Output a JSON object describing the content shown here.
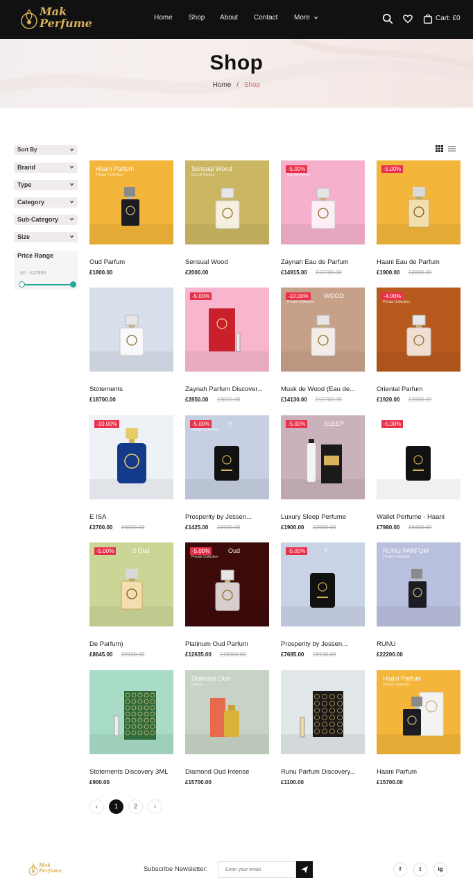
{
  "header": {
    "logo_line1": "Mak",
    "logo_line2": "Perfume",
    "nav": [
      {
        "label": "Home"
      },
      {
        "label": "Shop"
      },
      {
        "label": "About"
      },
      {
        "label": "Contact"
      },
      {
        "label": "More"
      }
    ],
    "cart_label": "Cart: £0",
    "icons": [
      "search-icon",
      "heart-icon",
      "bag-icon"
    ]
  },
  "hero": {
    "title": "Shop",
    "breadcrumb": {
      "home": "Home",
      "separator": "/",
      "current": "Shop"
    }
  },
  "sidebar": {
    "filters": [
      {
        "label": "Sort By"
      },
      {
        "label": "Brand"
      },
      {
        "label": "Type"
      },
      {
        "label": "Category"
      },
      {
        "label": "Sub-Category"
      },
      {
        "label": "Size"
      }
    ],
    "price_range": {
      "title": "Price Range",
      "value_text": "£0 - £22950",
      "slider_color": "#26a69a"
    }
  },
  "view_toggles": [
    "grid-view-icon",
    "list-view-icon"
  ],
  "products": [
    {
      "name": "Oud Parfum",
      "price": "£1800.00",
      "old_price": "",
      "badge": "",
      "overlay": "Haani Parfum",
      "overlay_sub": "Private Collection",
      "bg": "#f3b53a",
      "bottle": "dark"
    },
    {
      "name": "Sensual Wood",
      "price": "£2000.00",
      "old_price": "",
      "badge": "",
      "overlay": "Sensual Wood",
      "overlay_sub": "Eau de Parfum",
      "bg": "#cbb662",
      "bottle": "clear"
    },
    {
      "name": "Zaynah Eau de Parfum",
      "price": "£14915.00",
      "old_price": "£15700.00",
      "badge": "-5.00%",
      "overlay": "",
      "overlay_sub": "Eau de Parfum",
      "bg": "#f5b1cc",
      "bottle": "clear"
    },
    {
      "name": "Haani Eau de Parfum",
      "price": "£1900.00",
      "old_price": "£2000.00",
      "badge": "-5.00%",
      "overlay": "",
      "overlay_sub": "",
      "bg": "#f3b53a",
      "bottle": "gold"
    },
    {
      "name": "Stotements",
      "price": "£18700.00",
      "old_price": "",
      "badge": "",
      "overlay": "",
      "overlay_sub": "",
      "bg": "#d7dfea",
      "bottle": "clear"
    },
    {
      "name": "Zaynah Parfum Discover...",
      "price": "£2850.00",
      "old_price": "£3000.00",
      "badge": "-5.00%",
      "overlay": "",
      "overlay_sub": "",
      "bg": "#f7b6ce",
      "bottle": "box-red"
    },
    {
      "name": "Musk de Wood (Eau de...",
      "price": "£14130.00",
      "old_price": "£15700.00",
      "badge": "-10.00%",
      "overlay": "WOOD",
      "overlay_sub": "Private Collection",
      "bg": "#c7a089",
      "bottle": "clear"
    },
    {
      "name": "Oriental Parfum",
      "price": "£1920.00",
      "old_price": "£2000.00",
      "badge": "-4.00%",
      "overlay": "",
      "overlay_sub": "Private Collection",
      "bg": "#b85a1e",
      "bottle": "clear"
    },
    {
      "name": "E ISA",
      "price": "£2700.00",
      "old_price": "£3000.00",
      "badge": "-10.00%",
      "overlay": "",
      "overlay_sub": "",
      "bg": "#eef2f6",
      "bottle": "blue"
    },
    {
      "name": "Prosperity by Jessen...",
      "price": "£1425.00",
      "old_price": "£1500.00",
      "badge": "-5.00%",
      "overlay": "Y",
      "overlay_sub": "Parfum Collection",
      "bg": "#c6d0e2",
      "bottle": "wallet"
    },
    {
      "name": "Luxury Sleep Perfume",
      "price": "£1900.00",
      "old_price": "£2000.00",
      "badge": "-5.00%",
      "overlay": "SLEEP",
      "overlay_sub": "",
      "bg": "#c9b2bb",
      "bottle": "spray"
    },
    {
      "name": "Wallet Perfume - Haani",
      "price": "£7980.00",
      "old_price": "£8400.00",
      "badge": "-5.00%",
      "overlay": "",
      "overlay_sub": "",
      "bg": "#ffffff",
      "bottle": "wallet"
    },
    {
      "name": "De Parfum)",
      "price": "£8645.00",
      "old_price": "£9100.00",
      "badge": "-5.00%",
      "overlay": "d Oud",
      "overlay_sub": "",
      "bg": "#cbd596",
      "bottle": "gold"
    },
    {
      "name": "Platinum Oud Parfum",
      "price": "£12635.00",
      "old_price": "£13300.00",
      "badge": "-5.00%",
      "overlay": "Oud",
      "overlay_sub": "Private Collection",
      "bg": "#3d0a0a",
      "bottle": "clear"
    },
    {
      "name": "Prosperity by Jessen...",
      "price": "£7695.00",
      "old_price": "£8100.00",
      "badge": "-5.00%",
      "overlay": "Y",
      "overlay_sub": "",
      "bg": "#c8d3e6",
      "bottle": "wallet"
    },
    {
      "name": "RUNU",
      "price": "£22200.00",
      "old_price": "",
      "badge": "",
      "overlay": "RUNU PARFUM",
      "overlay_sub": "Private Collection",
      "bg": "#b9c0dd",
      "bottle": "dark"
    },
    {
      "name": "Stotements Discovery 3ML",
      "price": "£900.00",
      "old_price": "",
      "badge": "",
      "overlay": "",
      "overlay_sub": "",
      "bg": "#a8dcc6",
      "bottle": "box-green"
    },
    {
      "name": "Diamond Oud Intense",
      "price": "£15700.00",
      "old_price": "",
      "badge": "",
      "overlay": "Diamond Oud",
      "overlay_sub": "Intense",
      "bg": "#c7d4c5",
      "bottle": "box-red-gold"
    },
    {
      "name": "Runu Parfum Discovery...",
      "price": "£1100.00",
      "old_price": "",
      "badge": "",
      "overlay": "",
      "overlay_sub": "",
      "bg": "#e1e6e8",
      "bottle": "box-dark"
    },
    {
      "name": "Haani Parfum",
      "price": "£15700.00",
      "old_price": "",
      "badge": "",
      "overlay": "Haani Parfum",
      "overlay_sub": "Private Collection",
      "bg": "#f3b53a",
      "bottle": "dark-box"
    }
  ],
  "pagination": {
    "prev": "‹",
    "pages": [
      "1",
      "2"
    ],
    "next": "›",
    "current": "1"
  },
  "footer": {
    "newsletter_label": "Subscribe Newsletter:",
    "newsletter_placeholder": "Enter your email",
    "socials": [
      {
        "label": "f"
      },
      {
        "label": "t"
      },
      {
        "label": "ig"
      }
    ]
  }
}
